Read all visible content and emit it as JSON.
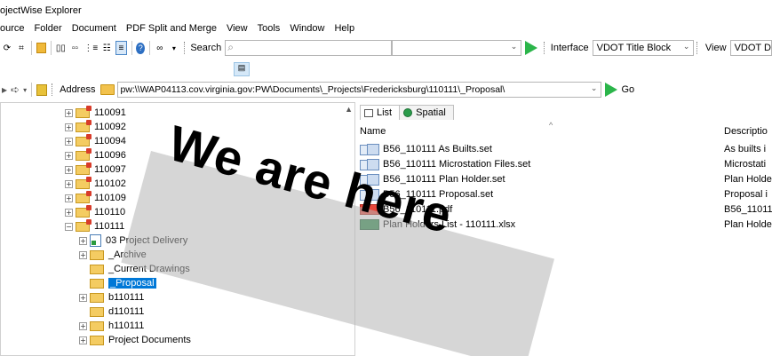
{
  "window": {
    "title": "ojectWise Explorer"
  },
  "menubar": {
    "items": [
      "ource",
      "Folder",
      "Document",
      "PDF Split and Merge",
      "View",
      "Tools",
      "Window",
      "Help"
    ]
  },
  "toolbar": {
    "search_label": "Search",
    "search_value": "",
    "interface_label": "Interface",
    "interface_value": "VDOT Title Block",
    "view_label": "View",
    "view_value": "VDOT Desi"
  },
  "address": {
    "label": "Address",
    "value": "pw:\\\\WAP04113.cov.virginia.gov:PW\\Documents\\_Projects\\Fredericksburg\\110111\\_Proposal\\",
    "go_label": "Go"
  },
  "tree": {
    "items": [
      {
        "label": "110091",
        "expander": "+",
        "icon": "project-folder"
      },
      {
        "label": "110092",
        "expander": "+",
        "icon": "project-folder"
      },
      {
        "label": "110094",
        "expander": "+",
        "icon": "project-folder"
      },
      {
        "label": "110096",
        "expander": "+",
        "icon": "project-folder"
      },
      {
        "label": "110097",
        "expander": "+",
        "icon": "project-folder"
      },
      {
        "label": "110102",
        "expander": "+",
        "icon": "project-folder"
      },
      {
        "label": "110109",
        "expander": "+",
        "icon": "project-folder"
      },
      {
        "label": "110110",
        "expander": "+",
        "icon": "project-folder"
      },
      {
        "label": "110111",
        "expander": "-",
        "icon": "project-folder"
      },
      {
        "label": "03 Project Delivery",
        "expander": "+",
        "icon": "document"
      },
      {
        "label": "_Archive",
        "expander": "+",
        "icon": "folder"
      },
      {
        "label": "_Current Drawings",
        "expander": "",
        "icon": "folder"
      },
      {
        "label": "_Proposal",
        "expander": "",
        "icon": "folder",
        "selected": true
      },
      {
        "label": "b110111",
        "expander": "+",
        "icon": "folder"
      },
      {
        "label": "d110111",
        "expander": "",
        "icon": "folder"
      },
      {
        "label": "h110111",
        "expander": "+",
        "icon": "folder"
      },
      {
        "label": "Project Documents",
        "expander": "+",
        "icon": "folder"
      }
    ]
  },
  "tabs": {
    "list": "List",
    "spatial": "Spatial"
  },
  "columns": {
    "name": "Name",
    "description": "Descriptio"
  },
  "files": [
    {
      "name": "B56_110111 As Builts.set",
      "description": "As builts i",
      "icon": "set"
    },
    {
      "name": "B56_110111 Microstation Files.set",
      "description": "Microstati",
      "icon": "set"
    },
    {
      "name": "B56_110111 Plan Holder.set",
      "description": "Plan Holde",
      "icon": "set"
    },
    {
      "name": "B56_110111 Proposal.set",
      "description": "Proposal i",
      "icon": "set"
    },
    {
      "name": "B56_110111.pdf",
      "description": "B56_11011",
      "icon": "pdf"
    },
    {
      "name": "Plan Holders List - 110111.xlsx",
      "description": "Plan Holde",
      "icon": "xlsx"
    }
  ],
  "watermark": {
    "text": "We are here"
  },
  "colors": {
    "selection": "#0078d7",
    "go_arrow": "#2bb54a",
    "folder": "#f4cc62"
  }
}
